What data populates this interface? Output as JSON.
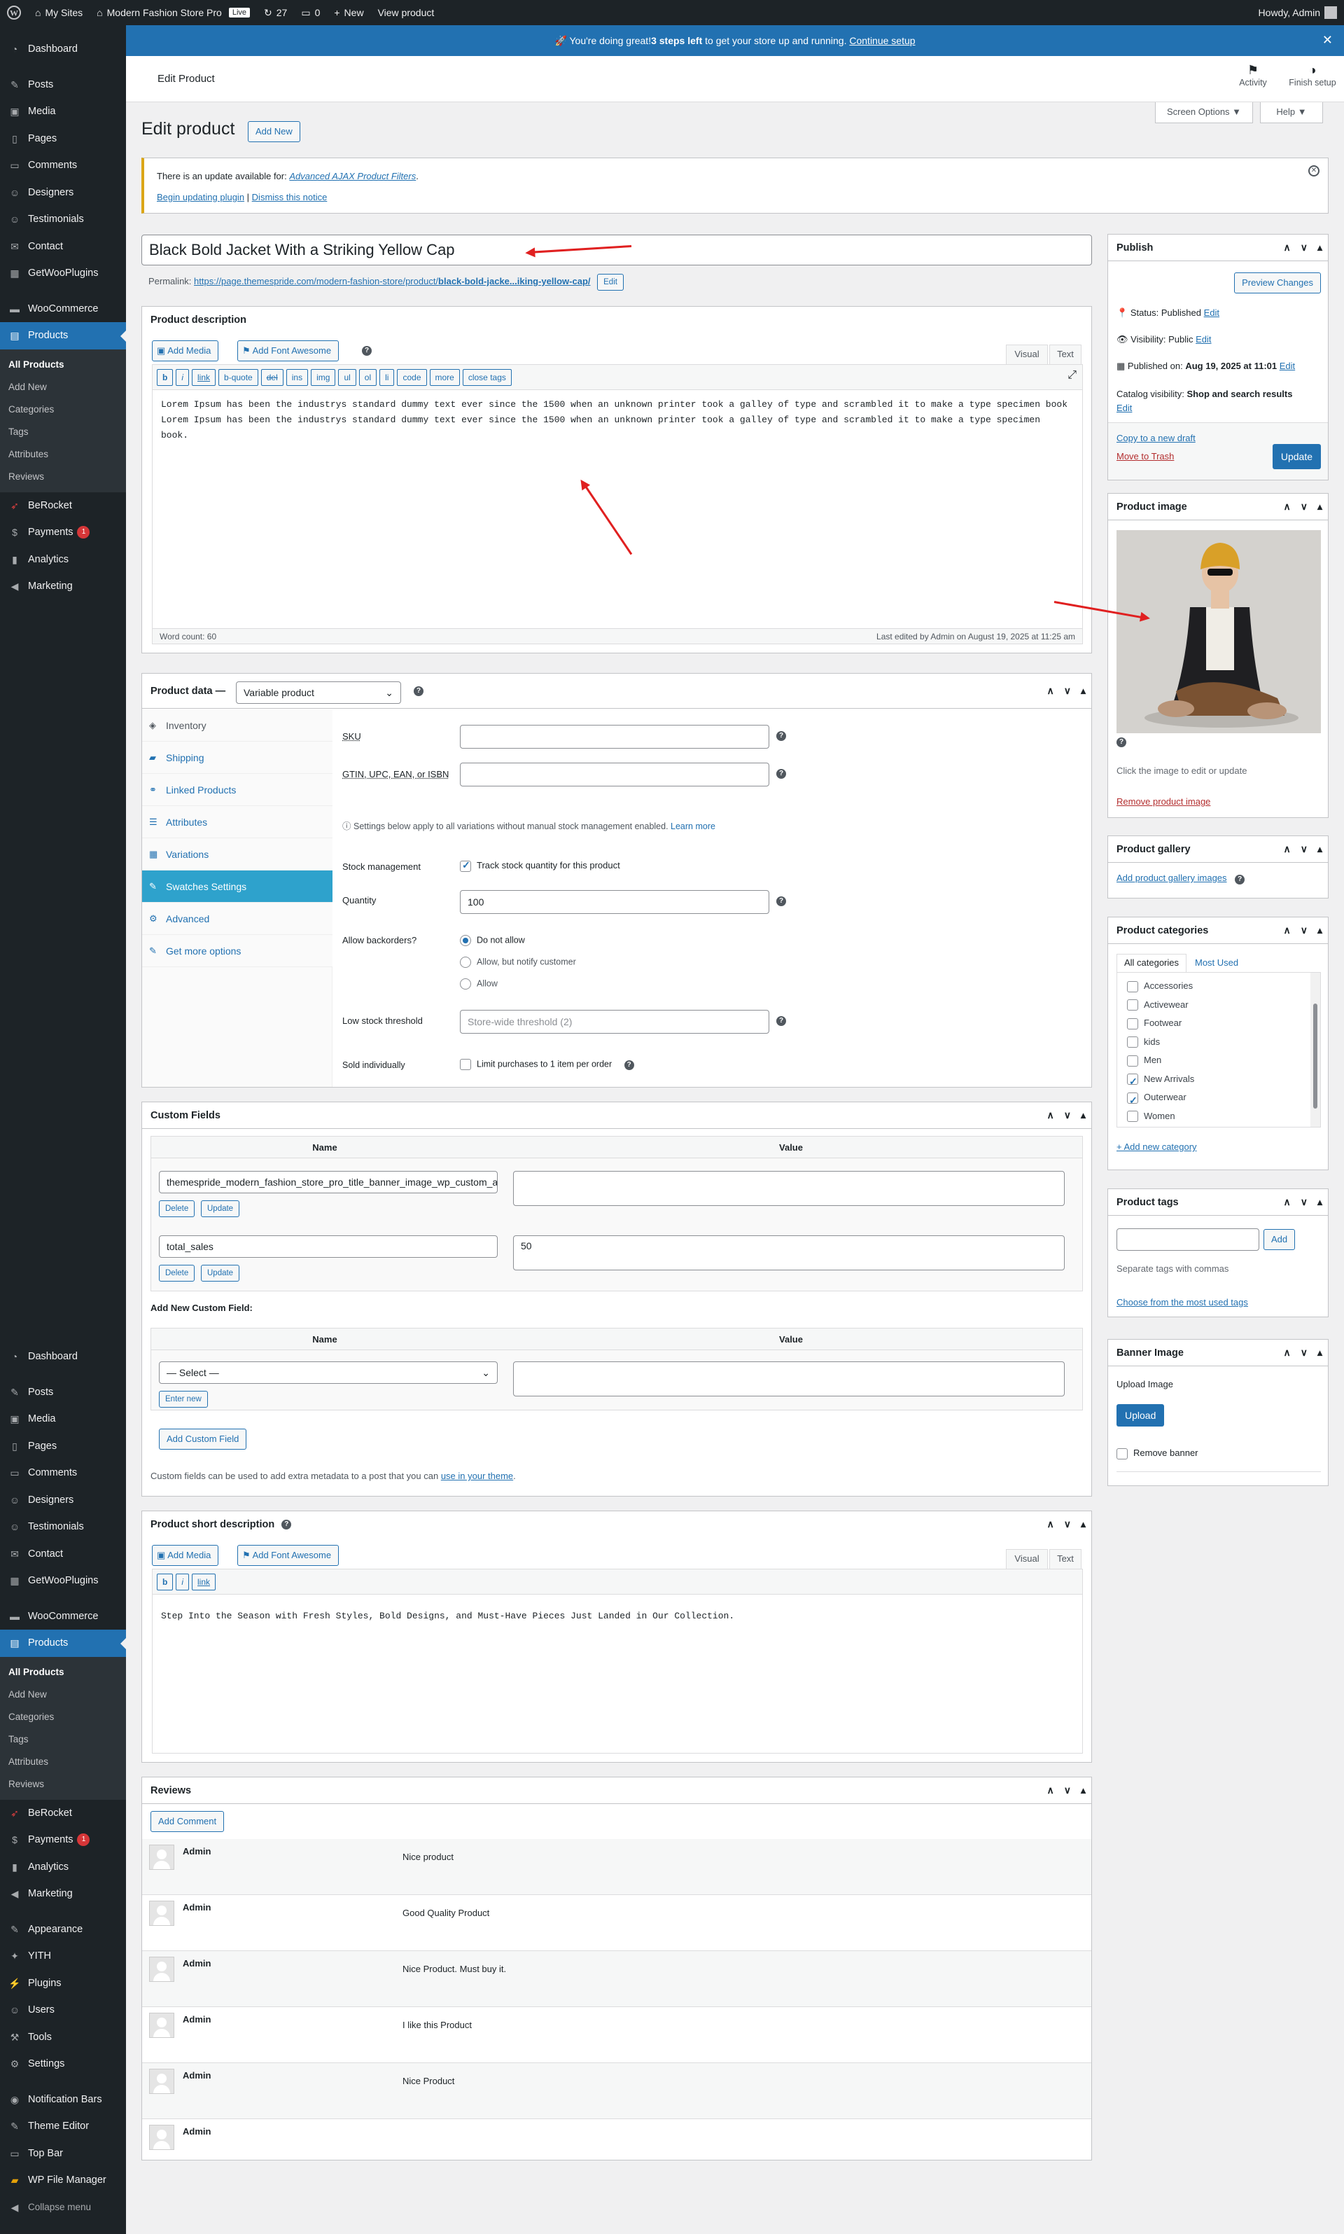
{
  "adminbar": {
    "my_sites": "My Sites",
    "site": "Modern Fashion Store Pro",
    "live": "Live",
    "updates": "27",
    "comments": "0",
    "new": "New",
    "view": "View product",
    "howdy": "Howdy, Admin"
  },
  "setup": {
    "text1": "🚀 You're doing great! ",
    "bold": "3 steps left",
    "text2": " to get your store up and running. ",
    "link": "Continue setup"
  },
  "header": {
    "title": "Edit Product",
    "activity": "Activity",
    "finish": "Finish setup",
    "screen_options": "Screen Options ▼",
    "help": "Help ▼"
  },
  "page": {
    "title": "Edit product",
    "add_new": "Add New"
  },
  "notice": {
    "text": "There is an update available for: ",
    "plugin": "Advanced AJAX Product Filters",
    "after": ".",
    "begin": "Begin updating plugin",
    "sep": " | ",
    "dismiss": "Dismiss this notice"
  },
  "product": {
    "title": "Black Bold Jacket With a Striking Yellow Cap",
    "permalink_label": "Permalink: ",
    "permalink_base": "https://page.themespride.com/modern-fashion-store/product/",
    "permalink_slug": "black-bold-jacke...iking-yellow-cap/",
    "edit": "Edit"
  },
  "desc": {
    "heading": "Product description",
    "add_media": "Add Media",
    "add_fa": "Add Font Awesome",
    "visual": "Visual",
    "text": "Text",
    "qtags": [
      "b",
      "i",
      "link",
      "b-quote",
      "del",
      "ins",
      "img",
      "ul",
      "ol",
      "li",
      "code",
      "more",
      "close tags"
    ],
    "content": "Lorem Ipsum has been the industrys standard dummy text ever since the 1500 when an unknown printer took a galley of type and scrambled it to make a type specimen book Lorem Ipsum has been the industrys standard dummy text ever since the 1500 when an unknown printer took a galley of type and scrambled it to make a type specimen book.",
    "word_count": "Word count: 60",
    "last_edited": "Last edited by Admin on August 19, 2025 at 11:25 am"
  },
  "pdata": {
    "label": "Product data —",
    "type": "Variable product",
    "tabs": [
      "Inventory",
      "Shipping",
      "Linked Products",
      "Attributes",
      "Variations",
      "Swatches Settings",
      "Advanced",
      "Get more options"
    ],
    "sku": "SKU",
    "gtin": "GTIN, UPC, EAN, or ISBN",
    "info": "Settings below apply to all variations without manual stock management enabled. ",
    "learn": "Learn more",
    "stock_mgmt": "Stock management",
    "track": "Track stock quantity for this product",
    "quantity": "Quantity",
    "qty_val": "100",
    "backorders": "Allow backorders?",
    "bo": [
      "Do not allow",
      "Allow, but notify customer",
      "Allow"
    ],
    "low": "Low stock threshold",
    "low_ph": "Store-wide threshold (2)",
    "sold": "Sold individually",
    "limit": "Limit purchases to 1 item per order"
  },
  "custom": {
    "heading": "Custom Fields",
    "name": "Name",
    "value": "Value",
    "rows": [
      {
        "key": "themespride_modern_fashion_store_pro_title_banner_image_wp_custom_attachment",
        "val": ""
      },
      {
        "key": "total_sales",
        "val": "50"
      }
    ],
    "delete": "Delete",
    "update": "Update",
    "add_new_label": "Add New Custom Field:",
    "select": "— Select —",
    "enter_new": "Enter new",
    "add_btn": "Add Custom Field",
    "note": "Custom fields can be used to add extra metadata to a post that you can ",
    "note_link": "use in your theme",
    "note_end": "."
  },
  "short": {
    "heading": "Product short description",
    "content": "Step Into the Season with Fresh Styles, Bold Designs, and Must-Have Pieces Just Landed in Our Collection.",
    "qtags": [
      "b",
      "i",
      "link"
    ]
  },
  "reviews": {
    "heading": "Reviews",
    "add": "Add Comment",
    "items": [
      {
        "author": "Admin",
        "text": "Nice product"
      },
      {
        "author": "Admin",
        "text": "Good Quality Product"
      },
      {
        "author": "Admin",
        "text": "Nice Product. Must buy it."
      },
      {
        "author": "Admin",
        "text": "I like this Product"
      },
      {
        "author": "Admin",
        "text": "Nice Product"
      },
      {
        "author": "Admin",
        "text": ""
      }
    ]
  },
  "publish": {
    "heading": "Publish",
    "preview": "Preview Changes",
    "status_l": "Status: ",
    "status": "Published",
    "vis_l": "Visibility: ",
    "vis": "Public",
    "pub_l": "Published on: ",
    "pub": "Aug 19, 2025 at 11:01",
    "edit": "Edit",
    "cat_l": "Catalog visibility: ",
    "cat": "Shop and search results",
    "copy": "Copy to a new draft",
    "trash": "Move to Trash",
    "update": "Update"
  },
  "pimage": {
    "heading": "Product image",
    "click": "Click the image to edit or update",
    "remove": "Remove product image"
  },
  "gallery": {
    "heading": "Product gallery",
    "add": "Add product gallery images"
  },
  "cats": {
    "heading": "Product categories",
    "all": "All categories",
    "most": "Most Used",
    "items": [
      "Accessories",
      "Activewear",
      "Footwear",
      "kids",
      "Men",
      "New Arrivals",
      "Outerwear",
      "Women"
    ],
    "checked": [
      false,
      false,
      false,
      false,
      false,
      true,
      true,
      false
    ],
    "add": "+ Add new category"
  },
  "tags": {
    "heading": "Product tags",
    "add": "Add",
    "sep": "Separate tags with commas",
    "choose": "Choose from the most used tags"
  },
  "banner": {
    "heading": "Banner Image",
    "upload_label": "Upload Image",
    "upload": "Upload",
    "remove": "Remove banner"
  },
  "menu": {
    "top": [
      "Dashboard",
      "Posts",
      "Media",
      "Pages",
      "Comments",
      "Designers",
      "Testimonials",
      "Contact",
      "GetWooPlugins",
      "WooCommerce",
      "Products"
    ],
    "sub": [
      "All Products",
      "Add New",
      "Categories",
      "Tags",
      "Attributes",
      "Reviews"
    ],
    "bottom": [
      "BeRocket",
      "Payments",
      "Analytics",
      "Marketing"
    ],
    "payments_badge": "1",
    "extra": [
      "Appearance",
      "YITH",
      "Plugins",
      "Users",
      "Tools",
      "Settings",
      "Notification Bars",
      "Theme Editor",
      "Top Bar",
      "WP File Manager",
      "Collapse menu"
    ]
  },
  "colors": {
    "primary": "#2271b1",
    "sidebar": "#1d2327",
    "current": "#2ea2cc",
    "arrow": "#e02020"
  }
}
